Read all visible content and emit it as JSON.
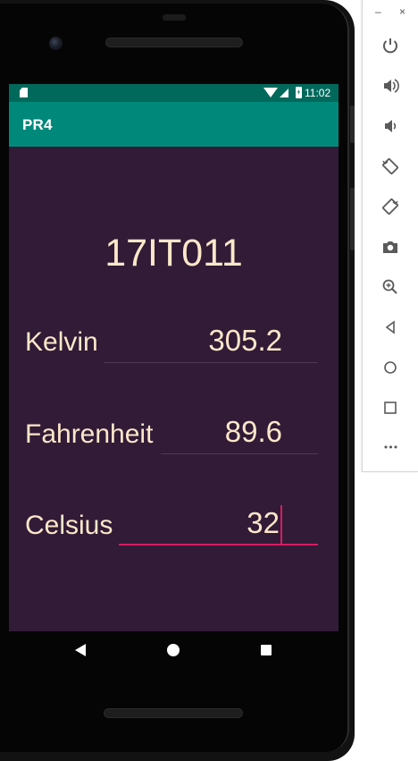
{
  "status_bar": {
    "time": "11:02"
  },
  "app_bar": {
    "title": "PR4"
  },
  "content": {
    "heading": "17IT011",
    "kelvin": {
      "label": "Kelvin",
      "value": "305.2"
    },
    "fahrenheit": {
      "label": "Fahrenheit",
      "value": "89.6"
    },
    "celsius": {
      "label": "Celsius",
      "value": "32"
    }
  },
  "emulator_panel": {
    "window_minimize": "–",
    "window_close": "×",
    "more": "•••",
    "tools": [
      "power-icon",
      "volume-up-icon",
      "volume-down-icon",
      "rotate-left-icon",
      "rotate-right-icon",
      "camera-icon",
      "zoom-icon",
      "back-icon",
      "home-icon",
      "overview-icon",
      "more-icon"
    ]
  },
  "colors": {
    "status_bar": "#00695c",
    "app_bar": "#00897b",
    "background": "#311b37",
    "text": "#fde7c9",
    "accent": "#d81b60"
  }
}
